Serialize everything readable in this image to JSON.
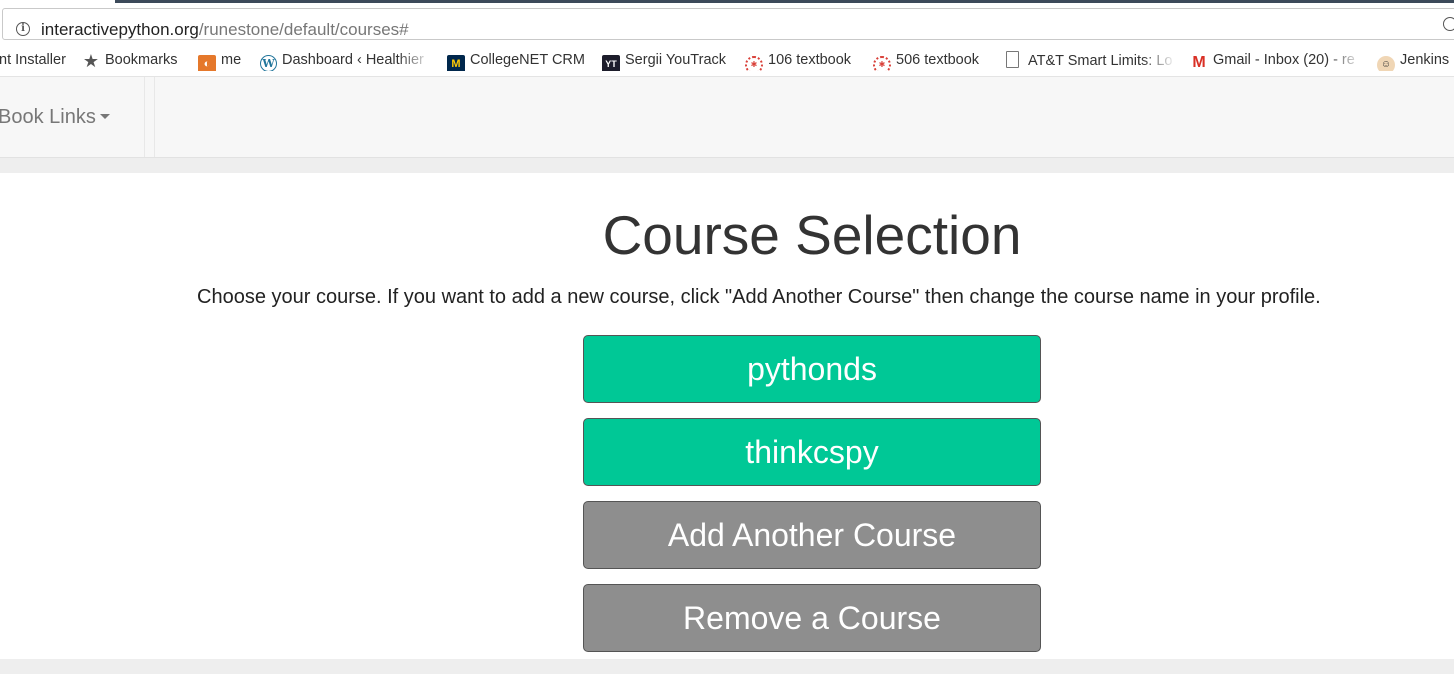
{
  "browser": {
    "url_host": "interactivepython.org",
    "url_path": "/runestone/default/courses#"
  },
  "bookmarks": [
    {
      "label": "nt Installer",
      "icon": "none"
    },
    {
      "label": "Bookmarks",
      "icon": "star-icon"
    },
    {
      "label": "me",
      "icon": "orange-app-icon"
    },
    {
      "label": "Dashboard ‹ Healthier",
      "icon": "wordpress-icon"
    },
    {
      "label": "CollegeNET CRM",
      "icon": "michigan-m-icon"
    },
    {
      "label": "Sergii YouTrack",
      "icon": "youtrack-icon"
    },
    {
      "label": "106 textbook",
      "icon": "runestone-icon"
    },
    {
      "label": "506 textbook",
      "icon": "runestone-icon"
    },
    {
      "label": "AT&T Smart Limits: Lo",
      "icon": "page-icon"
    },
    {
      "label": "Gmail - Inbox (20) - re",
      "icon": "gmail-icon"
    },
    {
      "label": "Jenkins",
      "icon": "jenkins-icon"
    }
  ],
  "navbar": {
    "book_links_label": "Book Links"
  },
  "main": {
    "title": "Course Selection",
    "instructions": "Choose your course. If you want to add a new course, click \"Add Another Course\" then change the course name in your profile.",
    "courses": [
      "pythonds",
      "thinkcspy"
    ],
    "add_course_label": "Add Another Course",
    "remove_course_label": "Remove a Course"
  },
  "colors": {
    "course_button": "#00c896",
    "action_button": "#8e8e8e"
  }
}
